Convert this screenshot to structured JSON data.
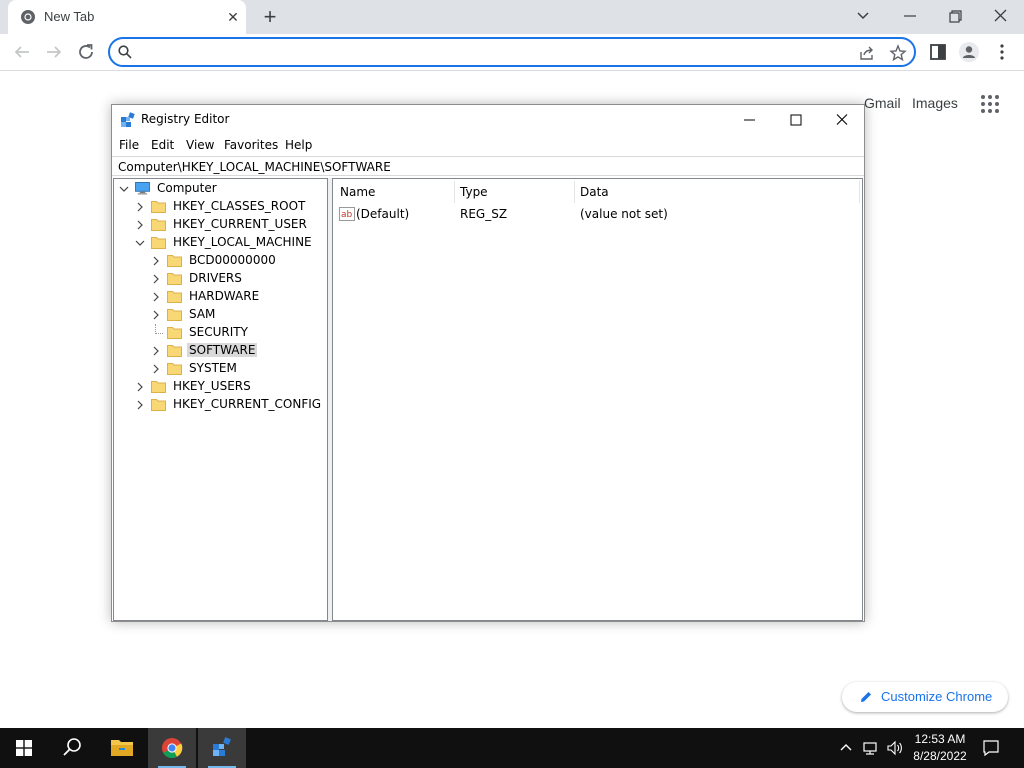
{
  "browser": {
    "tab_title": "New Tab",
    "omnibox_value": "",
    "ntp_links": {
      "gmail": "Gmail",
      "images": "Images"
    },
    "customize_label": "Customize Chrome"
  },
  "regedit": {
    "title": "Registry Editor",
    "menu": [
      "File",
      "Edit",
      "View",
      "Favorites",
      "Help"
    ],
    "address": "Computer\\HKEY_LOCAL_MACHINE\\SOFTWARE",
    "tree": [
      {
        "label": "Computer",
        "level": 0,
        "expander": "expanded",
        "icon": "computer-icon"
      },
      {
        "label": "HKEY_CLASSES_ROOT",
        "level": 1,
        "expander": "collapsed",
        "icon": "folder-icon"
      },
      {
        "label": "HKEY_CURRENT_USER",
        "level": 1,
        "expander": "collapsed",
        "icon": "folder-icon"
      },
      {
        "label": "HKEY_LOCAL_MACHINE",
        "level": 1,
        "expander": "expanded",
        "icon": "folder-icon"
      },
      {
        "label": "BCD00000000",
        "level": 2,
        "expander": "collapsed",
        "icon": "folder-icon"
      },
      {
        "label": "DRIVERS",
        "level": 2,
        "expander": "collapsed",
        "icon": "folder-icon"
      },
      {
        "label": "HARDWARE",
        "level": 2,
        "expander": "collapsed",
        "icon": "folder-icon"
      },
      {
        "label": "SAM",
        "level": 2,
        "expander": "collapsed",
        "icon": "folder-icon"
      },
      {
        "label": "SECURITY",
        "level": 2,
        "expander": "none",
        "icon": "folder-icon"
      },
      {
        "label": "SOFTWARE",
        "level": 2,
        "expander": "collapsed",
        "icon": "folder-icon",
        "selected": true
      },
      {
        "label": "SYSTEM",
        "level": 2,
        "expander": "collapsed",
        "icon": "folder-icon"
      },
      {
        "label": "HKEY_USERS",
        "level": 1,
        "expander": "collapsed",
        "icon": "folder-icon"
      },
      {
        "label": "HKEY_CURRENT_CONFIG",
        "level": 1,
        "expander": "collapsed",
        "icon": "folder-icon"
      }
    ],
    "columns": {
      "name": "Name",
      "type": "Type",
      "data": "Data"
    },
    "values": [
      {
        "name": "(Default)",
        "type": "REG_SZ",
        "data": "(value not set)",
        "icon": "string-value-icon"
      }
    ]
  },
  "taskbar": {
    "apps": [
      "start-icon",
      "search-icon",
      "file-explorer-icon",
      "chrome-icon",
      "regedit-icon"
    ],
    "time": "12:53 AM",
    "date": "8/28/2022"
  },
  "colors": {
    "accent": "#1a73e8",
    "tabstrip": "#dee1e6",
    "taskbar": "#101010",
    "folder": "#f8d775"
  }
}
